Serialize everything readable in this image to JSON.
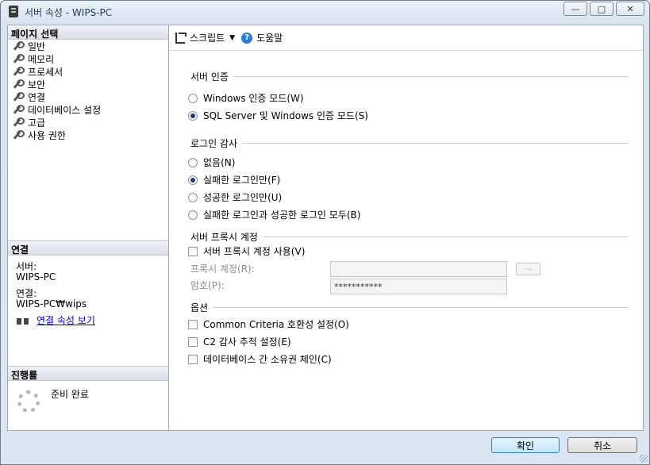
{
  "window": {
    "title": "서버 속성 - WIPS-PC",
    "controls": [
      "minimize",
      "maximize",
      "close"
    ]
  },
  "left_pane": {
    "pages_header": "페이지 선택",
    "pages": [
      {
        "label": "일반",
        "icon": "wrench-icon"
      },
      {
        "label": "메모리",
        "icon": "wrench-icon"
      },
      {
        "label": "프로세서",
        "icon": "wrench-icon"
      },
      {
        "label": "보안",
        "icon": "wrench-icon"
      },
      {
        "label": "연결",
        "icon": "wrench-icon"
      },
      {
        "label": "데이터베이스 설정",
        "icon": "wrench-icon"
      },
      {
        "label": "고급",
        "icon": "wrench-icon"
      },
      {
        "label": "사용 권한",
        "icon": "wrench-icon"
      }
    ],
    "connection_header": "연결",
    "server_label": "서버:",
    "server_value": "WIPS-PC",
    "connection_label": "연결:",
    "connection_value": "WIPS-PC₩wips",
    "view_properties_link": "연결 속성 보기",
    "progress_header": "진행률",
    "progress_status": "준비 완료"
  },
  "toolbar": {
    "script_label": "스크립트",
    "help_label": "도움말"
  },
  "security": {
    "auth_title": "서버 인증",
    "auth_options": [
      {
        "label": "Windows 인증 모드(W)",
        "selected": false
      },
      {
        "label": "SQL Server 및 Windows 인증 모드(S)",
        "selected": true
      }
    ],
    "audit_title": "로그인 감사",
    "audit_options": [
      {
        "label": "없음(N)",
        "selected": false
      },
      {
        "label": "실패한 로그인만(F)",
        "selected": true
      },
      {
        "label": "성공한 로그인만(U)",
        "selected": false
      },
      {
        "label": "실패한 로그인과 성공한 로그인 모두(B)",
        "selected": false
      }
    ],
    "proxy_title": "서버 프록시 계정",
    "proxy_enable_label": "서버 프록시 계정 사용(V)",
    "proxy_account_label": "프록시 계정(R):",
    "proxy_account_value": "",
    "proxy_password_label": "암호(P):",
    "proxy_password_value": "***********",
    "browse_label": "...",
    "options_title": "옵션",
    "options": [
      {
        "label": "Common Criteria 호환성 설정(O)",
        "checked": false
      },
      {
        "label": "C2 감사 추적 설정(E)",
        "checked": false
      },
      {
        "label": "데이터베이스 간 소유권 체인(C)",
        "checked": false
      }
    ]
  },
  "buttons": {
    "ok": "확인",
    "cancel": "취소"
  }
}
